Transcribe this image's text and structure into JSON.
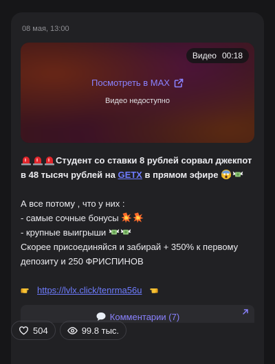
{
  "message": {
    "timestamp": "08 мая, 13:00"
  },
  "video": {
    "badge_label": "Видео",
    "duration": "00:18",
    "watch_label": "Посмотреть в MAX",
    "unavailable_label": "Видео недоступно"
  },
  "post": {
    "headline_1": "Студент со ставки 8 рублей сорвал джекпот",
    "headline_2a": "в 48 тысяч рублей на ",
    "headline_link": "GETX",
    "headline_2b": " в прямом эфире ",
    "line_reason": "А все потому , что у них :",
    "line_bonus": "- самые сочные бонусы ",
    "line_wins": "- крупные выигрыши ",
    "line_join_1": "Скорее присоединяйся и забирай + 350% к первому",
    "line_join_2": "депозиту и 250 ФРИСПИНОВ",
    "url": "https://lvlx.click/tenrma56u"
  },
  "comments": {
    "label": "Комментарии (7)"
  },
  "reactions": {
    "likes": "504",
    "views": "99.8 тыс."
  },
  "colors": {
    "background": "#161618",
    "card": "#212124",
    "accent": "#8a82ff",
    "link": "#6e7cff"
  },
  "icons": [
    "siren-icon",
    "scream-face-icon",
    "money-wings-icon",
    "collision-icon",
    "point-right-icon",
    "point-left-icon",
    "speech-bubble-icon",
    "external-link-icon",
    "arrow-up-right-icon",
    "heart-icon",
    "eye-icon"
  ]
}
